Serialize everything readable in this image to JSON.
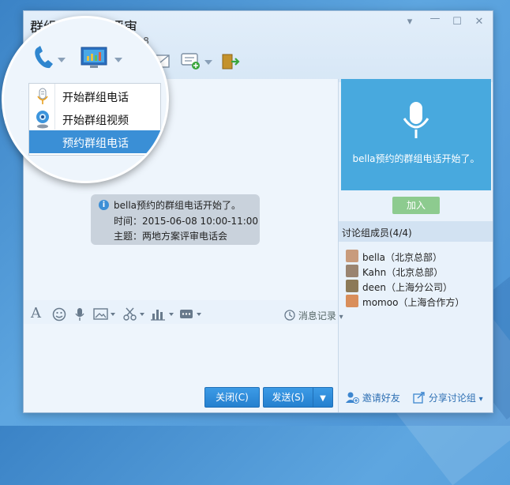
{
  "window": {
    "title": "群组电话会议评审",
    "subtitle_left": "be",
    "subtitle_right": "06-08"
  },
  "call_menu": {
    "items": [
      {
        "label": "开始群组电话"
      },
      {
        "label": "开始群组视频"
      },
      {
        "label": "预约群组电话"
      }
    ]
  },
  "chat": {
    "system_message": {
      "line1": "bella预约的群组电话开始了。",
      "line2": "时间：2015-06-08 10:00-11:00",
      "line3": "主题：两地方案评审电话会"
    }
  },
  "editor": {
    "history_label": "消息记录",
    "close_label": "关闭(C)",
    "send_label": "发送(S)"
  },
  "call_panel": {
    "status_text": "bella预约的群组电话开始了。",
    "join_label": "加入"
  },
  "members": {
    "header": "讨论组成员(4/4)",
    "list": [
      {
        "name": "bella（北京总部）",
        "avatar_color": "#c89b7c"
      },
      {
        "name": "Kahn（北京总部）",
        "avatar_color": "#9a8470"
      },
      {
        "name": "deen（上海分公司）",
        "avatar_color": "#8c7a58"
      },
      {
        "name": "momoo（上海合作方）",
        "avatar_color": "#d98e5a"
      }
    ]
  },
  "footer": {
    "invite_label": "邀请好友",
    "share_label": "分享讨论组"
  },
  "colors": {
    "accent": "#3a8fd6",
    "call_panel": "#48a9de",
    "join_button": "#8dcb8f"
  }
}
